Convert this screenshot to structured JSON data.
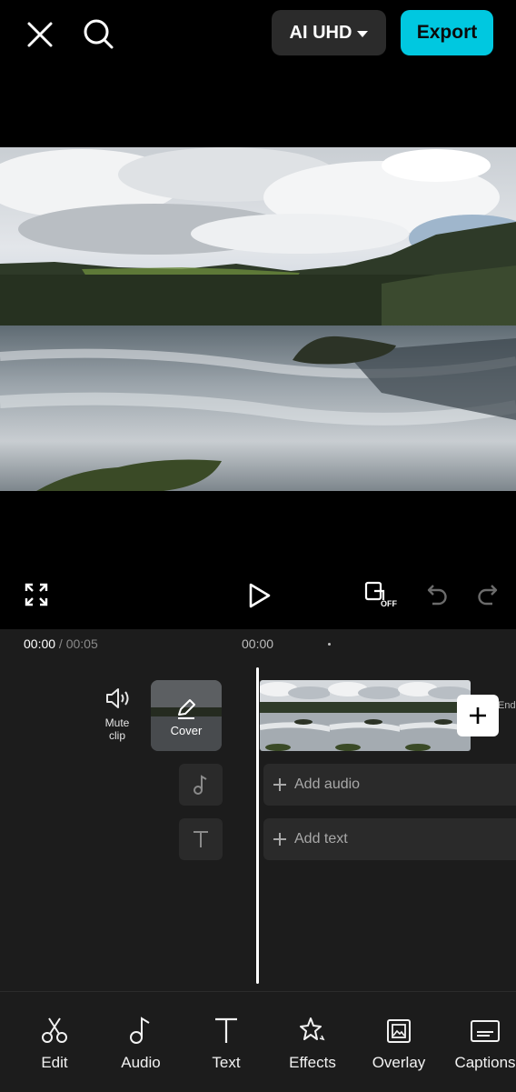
{
  "header": {
    "close_icon": "close-icon",
    "search_icon": "search-icon",
    "quality_label": "AI UHD",
    "export_label": "Export"
  },
  "controls": {
    "fullscreen_icon": "fullscreen-icon",
    "play_icon": "play-icon",
    "keyframe_badge": "OFF",
    "undo_icon": "undo-icon",
    "redo_icon": "redo-icon"
  },
  "timeline": {
    "current_time": "00:00",
    "total_time": "00:05",
    "ruler_label": "00:00",
    "mute_label_line1": "Mute",
    "mute_label_line2": "clip",
    "cover_label": "Cover",
    "end_label": "End",
    "add_audio": "Add audio",
    "add_text": "Add text"
  },
  "toolbar": {
    "items": [
      {
        "label": "Edit",
        "icon": "scissors-icon"
      },
      {
        "label": "Audio",
        "icon": "music-note-icon"
      },
      {
        "label": "Text",
        "icon": "text-icon"
      },
      {
        "label": "Effects",
        "icon": "sparkle-icon"
      },
      {
        "label": "Overlay",
        "icon": "overlay-icon"
      },
      {
        "label": "Captions",
        "icon": "captions-icon"
      }
    ]
  },
  "colors": {
    "accent": "#00c8e0",
    "background": "#000000",
    "panel": "#1c1c1c"
  }
}
